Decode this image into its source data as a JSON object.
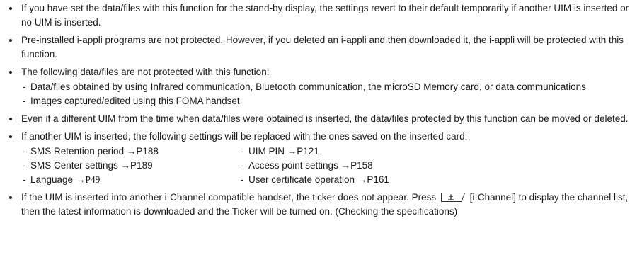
{
  "bullets": {
    "b1": "If you have set the data/files with this function for the stand-by display, the settings revert to their default temporarily if another UIM is inserted or no UIM is inserted.",
    "b2": "Pre-installed i-appli programs are not protected. However, if you deleted an i-appli and then downloaded it, the i-appli will be protected with this function.",
    "b3": {
      "text": "The following data/files are not protected with this function:",
      "sub": [
        "Data/files obtained by using Infrared communication, Bluetooth communication, the microSD Memory card, or data communications",
        "Images captured/edited using this FOMA handset"
      ]
    },
    "b4": "Even if a different UIM from the time when data/files were obtained is inserted, the data/files protected by this function can be moved or deleted.",
    "b5": {
      "text": "If another UIM is inserted, the following settings will be replaced with the ones saved on the inserted card:",
      "settings": [
        "SMS Retention period →P188",
        "UIM PIN →P121",
        "SMS Center settings →P189",
        "Access point settings →P158",
        "Language →",
        "User certificate operation →P161"
      ],
      "language_page": "P49"
    },
    "b6": {
      "before": "If the UIM is inserted into another i-Channel compatible handset, the ticker does not appear. Press",
      "after": "[i-Channel] to display the channel list, then the latest information is downloaded and the Ticker will be turned on. (Checking the specifications)",
      "key_icon": "i-channel-key-icon"
    }
  }
}
